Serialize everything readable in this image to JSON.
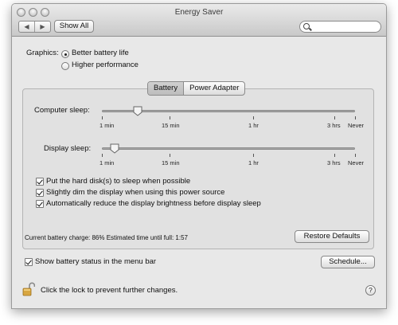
{
  "window": {
    "title": "Energy Saver"
  },
  "toolbar": {
    "back_label": "◀",
    "forward_label": "▶",
    "show_all_label": "Show All",
    "search_placeholder": ""
  },
  "graphics": {
    "label": "Graphics:",
    "options": [
      {
        "label": "Better battery life",
        "selected": true
      },
      {
        "label": "Higher performance",
        "selected": false
      }
    ]
  },
  "tabs": [
    {
      "label": "Battery",
      "active": true
    },
    {
      "label": "Power Adapter",
      "active": false
    }
  ],
  "computer_sleep": {
    "label": "Computer sleep:",
    "ticks": [
      "1 min",
      "15 min",
      "1 hr",
      "3 hrs",
      "Never"
    ],
    "value_fraction": 0.14
  },
  "display_sleep": {
    "label": "Display sleep:",
    "ticks": [
      "1 min",
      "15 min",
      "1 hr",
      "3 hrs",
      "Never"
    ],
    "value_fraction": 0.05
  },
  "options": [
    {
      "label": "Put the hard disk(s) to sleep when possible",
      "checked": true
    },
    {
      "label": "Slightly dim the display when using this power source",
      "checked": true
    },
    {
      "label": "Automatically reduce the display brightness before display sleep",
      "checked": true
    }
  ],
  "battery_status": "Current battery charge: 86%  Estimated time until full: 1:57",
  "restore_defaults_label": "Restore Defaults",
  "show_battery_status": {
    "label": "Show battery status in the menu bar",
    "checked": true
  },
  "schedule_label": "Schedule...",
  "lock_text": "Click the lock to prevent further changes.",
  "help_label": "?"
}
